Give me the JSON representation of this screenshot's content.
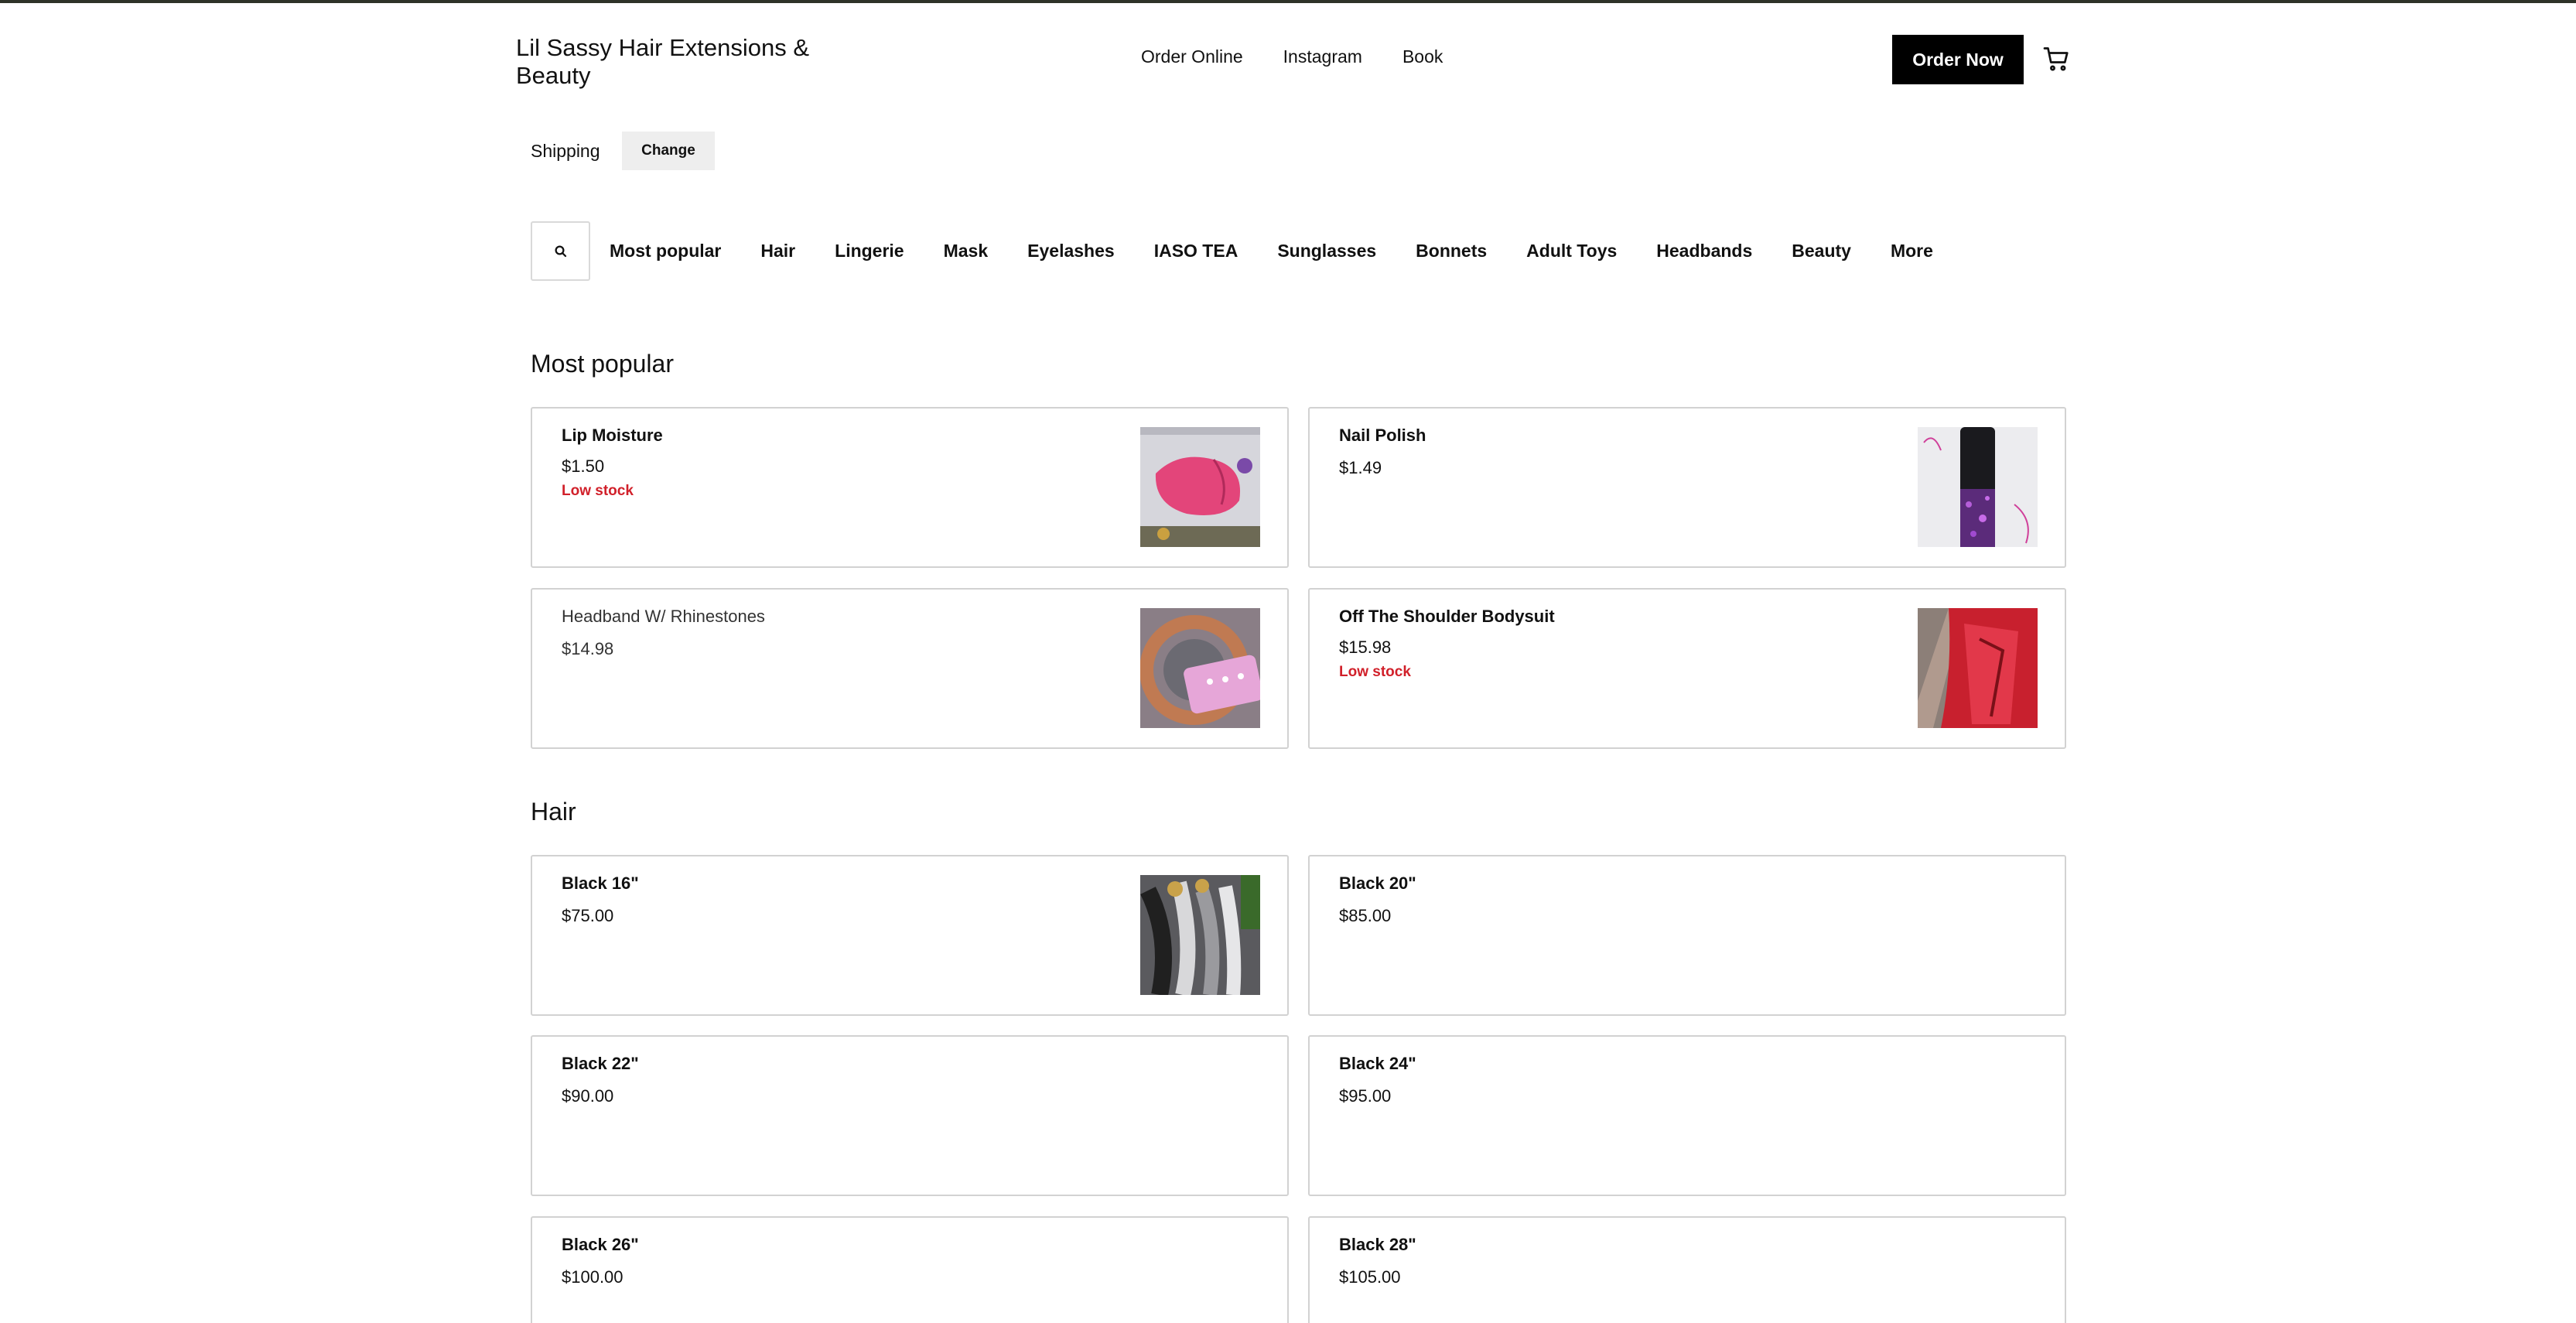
{
  "header": {
    "brand": "Lil Sassy Hair Extensions & Beauty",
    "nav": [
      "Order Online",
      "Instagram",
      "Book"
    ],
    "order_button": "Order Now",
    "cart_icon": "cart-icon"
  },
  "shipping": {
    "label": "Shipping",
    "change_label": "Change"
  },
  "categories": {
    "search_icon": "search-icon",
    "items": [
      "Most popular",
      "Hair",
      "Lingerie",
      "Mask",
      "Eyelashes",
      "IASO TEA",
      "Sunglasses",
      "Bonnets",
      "Adult Toys",
      "Headbands",
      "Beauty",
      "More"
    ]
  },
  "sections": {
    "most_popular": {
      "title": "Most popular",
      "items": [
        {
          "name": "Lip Moisture",
          "price": "$1.50",
          "stock": "Low stock"
        },
        {
          "name": "Nail Polish",
          "price": "$1.49"
        },
        {
          "name": "Headband W/ Rhinestones",
          "price": "$14.98"
        },
        {
          "name": "Off The Shoulder Bodysuit",
          "price": "$15.98",
          "stock": "Low stock"
        }
      ]
    },
    "hair": {
      "title": "Hair",
      "items": [
        {
          "name": "Black 16\"",
          "price": "$75.00"
        },
        {
          "name": "Black 20\"",
          "price": "$85.00"
        },
        {
          "name": "Black 22\"",
          "price": "$90.00"
        },
        {
          "name": "Black 24\"",
          "price": "$95.00"
        },
        {
          "name": "Black 26\"",
          "price": "$100.00"
        },
        {
          "name": "Black 28\"",
          "price": "$105.00"
        }
      ]
    }
  },
  "colors": {
    "button_bg": "#000000",
    "low_stock": "#d1202a",
    "card_border": "#d2d2d2",
    "chip_bg": "#eeeeee"
  }
}
